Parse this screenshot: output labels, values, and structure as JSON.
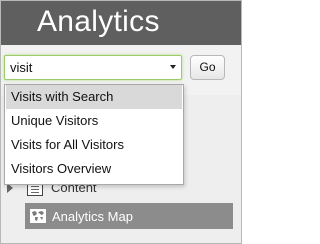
{
  "header": {
    "title": "Analytics"
  },
  "search": {
    "value": "visit",
    "go_label": "Go"
  },
  "dropdown": {
    "options": [
      "Visits with Search",
      "Unique Visitors",
      "Visits for All Visitors",
      "Visitors Overview"
    ],
    "highlighted_index": 0
  },
  "nav": {
    "items": [
      {
        "label": "Content",
        "icon": "page-icon"
      },
      {
        "label": "Analytics Map",
        "icon": "world-map-icon"
      }
    ]
  },
  "colors": {
    "header_bg": "#5f5f5f",
    "input_focus_border": "#9ccb6a",
    "selected_nav_bg": "#8c8c8c",
    "dropdown_highlight": "#d9d9d9"
  }
}
